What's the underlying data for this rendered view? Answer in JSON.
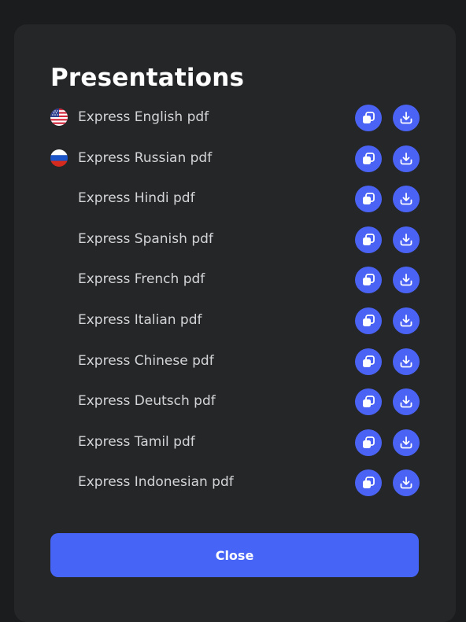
{
  "modal": {
    "title": "Presentations",
    "close_label": "Close"
  },
  "items": [
    {
      "label": "Express English pdf",
      "flag": "us-flag-icon"
    },
    {
      "label": "Express Russian pdf",
      "flag": "ru-flag-icon"
    },
    {
      "label": "Express Hindi pdf",
      "flag": null
    },
    {
      "label": "Express Spanish pdf",
      "flag": null
    },
    {
      "label": "Express French pdf",
      "flag": null
    },
    {
      "label": "Express Italian pdf",
      "flag": null
    },
    {
      "label": "Express Chinese pdf",
      "flag": null
    },
    {
      "label": "Express Deutsch pdf",
      "flag": null
    },
    {
      "label": "Express Tamil pdf",
      "flag": null
    },
    {
      "label": "Express Indonesian pdf",
      "flag": null
    }
  ],
  "icons": {
    "copy": "copy-icon",
    "download": "download-icon"
  },
  "colors": {
    "page_background": "#1b1c1e",
    "modal_background": "#252628",
    "accent": "#4a63f5",
    "text_primary": "#ffffff",
    "text_secondary": "#d4d5d8"
  }
}
